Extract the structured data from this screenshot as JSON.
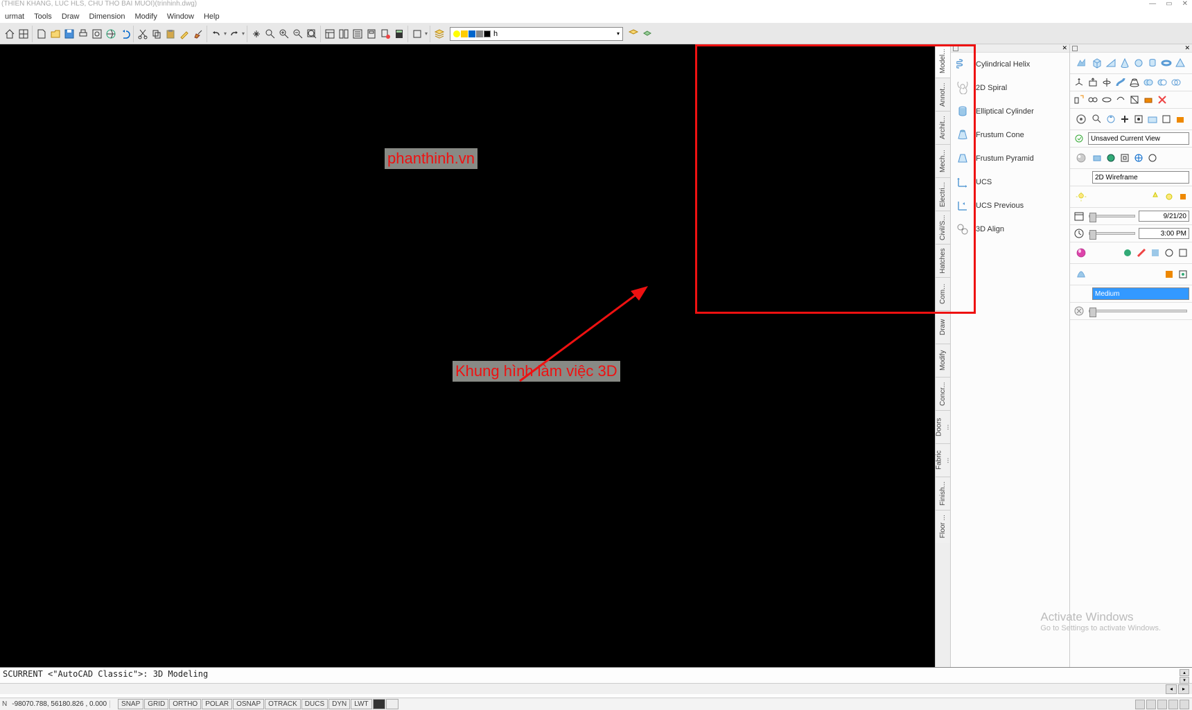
{
  "title": "(THIEN KHANG, LUC HLS, CHU THO BAI MUOI)(trinhinh.dwg)",
  "menu": [
    "urmat",
    "Tools",
    "Draw",
    "Dimension",
    "Modify",
    "Window",
    "Help"
  ],
  "layer_dropdown": "h",
  "annotations": {
    "watermark": "phanthinh.vn",
    "label": "Khung hình làm việc 3D"
  },
  "tabs": [
    "Model...",
    "Annot...",
    "Archit...",
    "Mech...",
    "Electri...",
    "Civil/S...",
    "Hatches",
    "Com...",
    "Draw",
    "Modify",
    "Concr...",
    "Doors ...",
    "Fabric ...",
    "Finish...",
    "Floor ..."
  ],
  "modeling_items": [
    "Cylindrical Helix",
    "2D Spiral",
    "Elliptical Cylinder",
    "Frustum Cone",
    "Frustum Pyramid",
    "UCS",
    "UCS Previous",
    "3D Align"
  ],
  "right2": {
    "view_dd": "Unsaved Current View",
    "style_dd": "2D Wireframe",
    "quality_dd": "Medium",
    "date": "9/21/20",
    "time": "3:00 PM"
  },
  "command": "SCURRENT <\"AutoCAD Classic\">: 3D Modeling",
  "status": {
    "coords": "-98070.788, 56180.826 , 0.000",
    "toggles": [
      "SNAP",
      "GRID",
      "ORTHO",
      "POLAR",
      "OSNAP",
      "OTRACK",
      "DUCS",
      "DYN",
      "LWT"
    ]
  },
  "activate": {
    "l1": "Activate Windows",
    "l2": "Go to Settings to activate Windows."
  }
}
